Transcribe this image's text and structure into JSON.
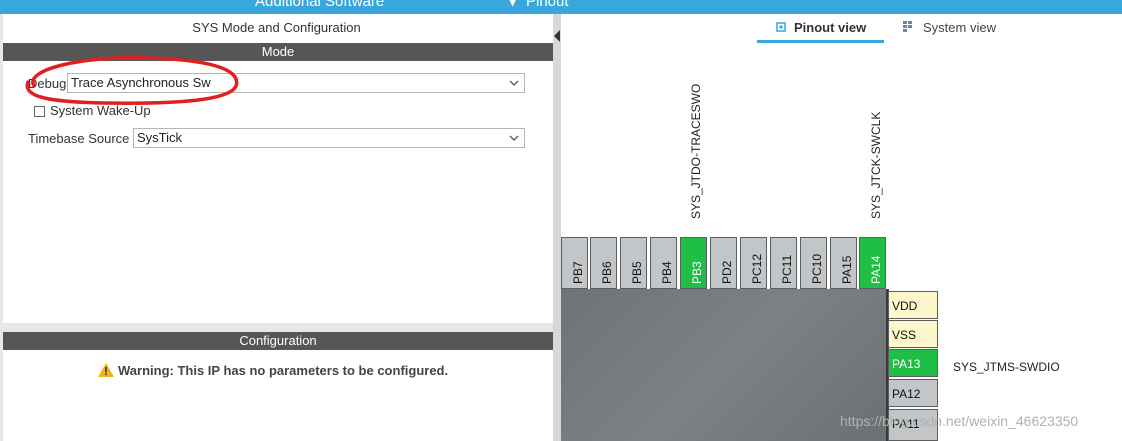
{
  "topbar": {
    "additional_software": "Additional Software",
    "pinout": "Pinout"
  },
  "sys_panel": {
    "title": "SYS Mode and Configuration",
    "mode_header": "Mode",
    "debug_label": "Debug",
    "debug_value": "Trace Asynchronous Sw",
    "wakeup_label": "System Wake-Up",
    "timebase_label": "Timebase Source",
    "timebase_value": "SysTick",
    "config_header": "Configuration",
    "warning": "Warning: This IP has no parameters to be configured."
  },
  "view_tabs": {
    "pinout_view": "Pinout view",
    "system_view": "System view"
  },
  "pins_top": [
    {
      "name": "PB7",
      "state": "default"
    },
    {
      "name": "PB6",
      "state": "default"
    },
    {
      "name": "PB5",
      "state": "default"
    },
    {
      "name": "PB4",
      "state": "default"
    },
    {
      "name": "PB3",
      "state": "assigned"
    },
    {
      "name": "PD2",
      "state": "default"
    },
    {
      "name": "PC12",
      "state": "default"
    },
    {
      "name": "PC11",
      "state": "default"
    },
    {
      "name": "PC10",
      "state": "default"
    },
    {
      "name": "PA15",
      "state": "default"
    },
    {
      "name": "PA14",
      "state": "assigned"
    }
  ],
  "pins_right": [
    {
      "name": "VDD",
      "state": "power"
    },
    {
      "name": "VSS",
      "state": "power"
    },
    {
      "name": "PA13",
      "state": "assigned"
    },
    {
      "name": "PA12",
      "state": "default"
    },
    {
      "name": "PA11",
      "state": "default"
    }
  ],
  "signal_labels": {
    "pb3": "SYS_JTDO-TRACESWO",
    "pa14": "SYS_JTCK-SWCLK",
    "pa13": "SYS_JTMS-SWDIO"
  },
  "watermark": "https://blog.csdn.net/weixin_46623350",
  "colors": {
    "accent": "#39a7dc",
    "assigned_pin": "#1fbf45",
    "power_pin": "#fff7cc",
    "default_pin": "#c3c6c8",
    "annotation": "#e02020"
  }
}
